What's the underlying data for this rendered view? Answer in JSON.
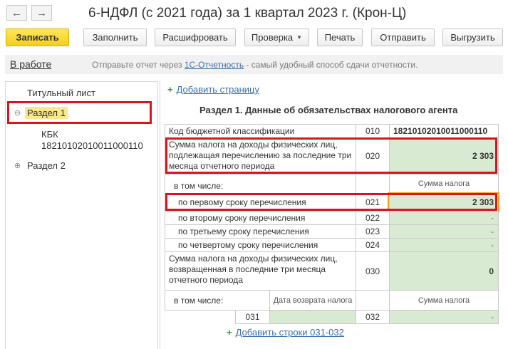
{
  "window": {
    "title": "6-НДФЛ (с 2021 года) за 1 квартал 2023 г. (Крон-Ц)",
    "back_icon": "arrow-left-icon",
    "forward_icon": "arrow-right-icon"
  },
  "toolbar": {
    "save": "Записать",
    "fill": "Заполнить",
    "decode": "Расшифровать",
    "check": "Проверка",
    "print": "Печать",
    "send": "Отправить",
    "export": "Выгрузить"
  },
  "status": {
    "state": "В работе",
    "hint_before": "Отправьте отчет через ",
    "hint_link": "1С-Отчетность",
    "hint_after": " - самый удобный способ сдачи отчетности."
  },
  "tree": {
    "title_page": "Титульный лист",
    "section1": "Раздел 1",
    "kbk_label": "КБК",
    "kbk_value": "18210102010011000110",
    "section2": "Раздел 2"
  },
  "main": {
    "add_page": "Добавить страницу",
    "section_title": "Раздел 1. Данные об обязательствах налогового агента",
    "kbk_row": {
      "label": "Код бюджетной классификации",
      "code": "010",
      "value": "18210102010011000110"
    },
    "row020": {
      "label": "Сумма налога на доходы физических лиц, подлежащая перечислению за последние три месяца отчетного периода",
      "code": "020",
      "value": "2 303"
    },
    "including": "в том числе:",
    "tax_sum_hdr": "Сумма налога",
    "row021": {
      "label": "по первому сроку перечисления",
      "code": "021",
      "value": "2 303"
    },
    "row022": {
      "label": "по второму сроку перечисления",
      "code": "022",
      "value": "-"
    },
    "row023": {
      "label": "по третьему сроку перечисления",
      "code": "023",
      "value": "-"
    },
    "row024": {
      "label": "по четвертому сроку перечисления",
      "code": "024",
      "value": "-"
    },
    "row030": {
      "label": "Сумма налога на доходы физических лиц, возвращенная в последние три месяца отчетного периода",
      "code": "030",
      "value": "0"
    },
    "including2": "в том числе:",
    "return_date_hdr": "Дата возврата налога",
    "tax_sum_hdr2": "Сумма налога",
    "row031": {
      "code": "031",
      "value": ""
    },
    "row032": {
      "code": "032",
      "value": "-"
    },
    "add_rows": "Добавить строки 031-032"
  },
  "colors": {
    "highlight_red": "#d8141f",
    "accent_yellow": "#f5cf1c",
    "value_green": "#d9ead3"
  }
}
